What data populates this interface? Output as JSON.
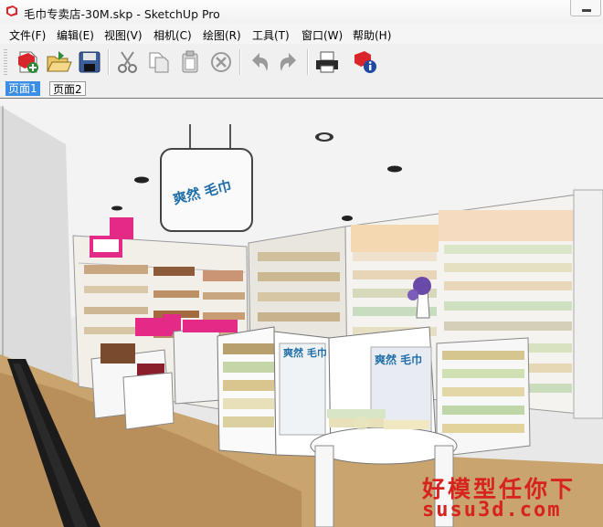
{
  "window": {
    "title": "毛巾专卖店-30M.skp - SketchUp Pro"
  },
  "menu": [
    {
      "label": "文件(F)"
    },
    {
      "label": "编辑(E)"
    },
    {
      "label": "视图(V)"
    },
    {
      "label": "相机(C)"
    },
    {
      "label": "绘图(R)"
    },
    {
      "label": "工具(T)"
    },
    {
      "label": "窗口(W)"
    },
    {
      "label": "帮助(H)"
    }
  ],
  "toolbar": [
    {
      "icon": "new-file-icon"
    },
    {
      "icon": "open-file-icon"
    },
    {
      "icon": "save-icon"
    },
    {
      "icon": "cut-icon"
    },
    {
      "icon": "copy-icon"
    },
    {
      "icon": "paste-icon"
    },
    {
      "icon": "erase-icon"
    },
    {
      "icon": "undo-icon"
    },
    {
      "icon": "redo-icon"
    },
    {
      "icon": "print-icon"
    },
    {
      "icon": "model-info-icon"
    }
  ],
  "tabs": [
    {
      "label": "页面1",
      "active": true
    },
    {
      "label": "页面2",
      "active": false
    }
  ],
  "scene": {
    "sign_main": "爽然 毛巾",
    "panel_brand": "爽然 毛巾",
    "store_logo": "爽然 毛巾",
    "watermark_line1": "好模型任你下",
    "watermark_line2": "susu3d.com"
  }
}
